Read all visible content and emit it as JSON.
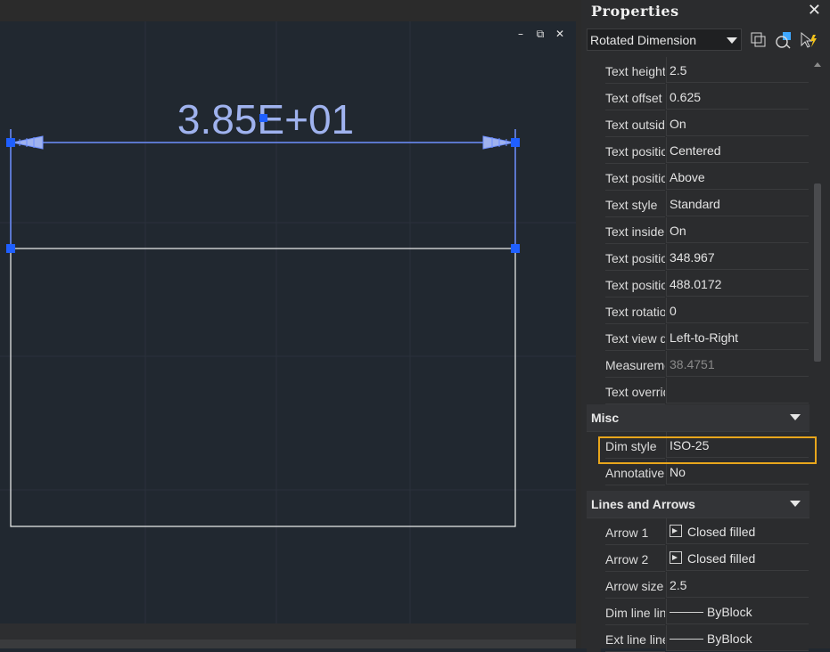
{
  "canvas": {
    "dimension_text": "3.85E+01",
    "controls": {
      "minimize": "–",
      "restore": "⧉",
      "close": "✕"
    }
  },
  "properties": {
    "title": "Properties",
    "close": "✕",
    "object_type": "Rotated Dimension",
    "text_rows": [
      {
        "name": "Text height",
        "value": "2.5"
      },
      {
        "name": "Text offset",
        "value": "0.625"
      },
      {
        "name": "Text outside align",
        "value": "On"
      },
      {
        "name": "Text position horizontal",
        "value": "Centered"
      },
      {
        "name": "Text position vertical",
        "value": "Above"
      },
      {
        "name": "Text style",
        "value": "Standard"
      },
      {
        "name": "Text inside align",
        "value": "On"
      },
      {
        "name": "Text position X",
        "value": "348.967"
      },
      {
        "name": "Text position Y",
        "value": "488.0172"
      },
      {
        "name": "Text rotation",
        "value": "0"
      },
      {
        "name": "Text view direction",
        "value": "Left-to-Right"
      },
      {
        "name": "Measurement",
        "value": "38.4751"
      },
      {
        "name": "Text override",
        "value": ""
      }
    ],
    "misc_section": "Misc",
    "misc_rows": [
      {
        "name": "Dim style",
        "value": "ISO-25"
      },
      {
        "name": "Annotative",
        "value": "No"
      }
    ],
    "lines_section": "Lines and Arrows",
    "lines_rows": [
      {
        "name": "Arrow 1",
        "value": "Closed filled"
      },
      {
        "name": "Arrow 2",
        "value": "Closed filled"
      },
      {
        "name": "Arrow size",
        "value": "2.5"
      },
      {
        "name": "Dim line linetype",
        "value": "ByBlock"
      },
      {
        "name": "Ext line linetype",
        "value": "ByBlock"
      }
    ]
  },
  "colors": {
    "accent": "#e8a61c",
    "dimension": "#9fb2ee",
    "grip": "#1f5fff"
  }
}
